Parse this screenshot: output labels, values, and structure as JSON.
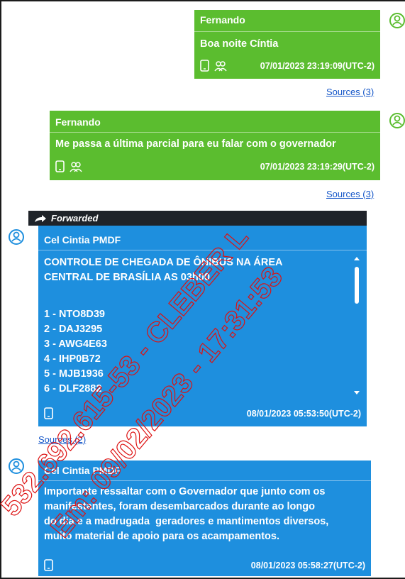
{
  "messages": [
    {
      "sender": "Fernando",
      "text": "Boa noite Cíntia",
      "timestamp": "07/01/2023 23:19:09(UTC-2)",
      "sources": "Sources (3)",
      "icons": [
        "phone-icon",
        "group-icon"
      ]
    },
    {
      "sender": "Fernando",
      "text": "Me passa a última parcial para eu falar com o governador",
      "timestamp": "07/01/2023 23:19:29(UTC-2)",
      "sources": "Sources (3)",
      "icons": [
        "phone-icon",
        "group-icon"
      ]
    },
    {
      "forwarded_label": "Forwarded",
      "sender": "Cel Cintia PMDF",
      "lines": [
        "CONTROLE DE CHEGADA DE ÔNIBUS NA ÁREA",
        "CENTRAL DE BRASÍLIA AS 03h00",
        "",
        "1 - NTO8D39",
        "2 - DAJ3295",
        "3 - AWG4E63",
        "4 - IHP0B72",
        "5 - MJB1936",
        "6 - DLF2882"
      ],
      "timestamp": "08/01/2023 05:53:50(UTC-2)",
      "sources": "Sources (2)",
      "icons": [
        "phone-icon"
      ]
    },
    {
      "sender": "Cel Cintia PMDF",
      "lines": [
        "Importante ressaltar com o Governador que junto com os",
        "manifestantes, foram desembarcados durante ao longo",
        "do dia e a madrugada  geradores e mantimentos diversos,",
        "muito material de apoio para os acampamentos."
      ],
      "timestamp": "08/01/2023 05:58:27(UTC-2)",
      "icons": [
        "phone-icon"
      ]
    }
  ],
  "watermark": {
    "line1": "532.692.615-53 - CLEBER L",
    "line2": "Em: 09/02/2023 - 17:31:53"
  },
  "colors": {
    "outgoing": "#5bbd2f",
    "incoming": "#1e8fde",
    "forward_bar": "#1f2329",
    "link": "#1456c8"
  }
}
